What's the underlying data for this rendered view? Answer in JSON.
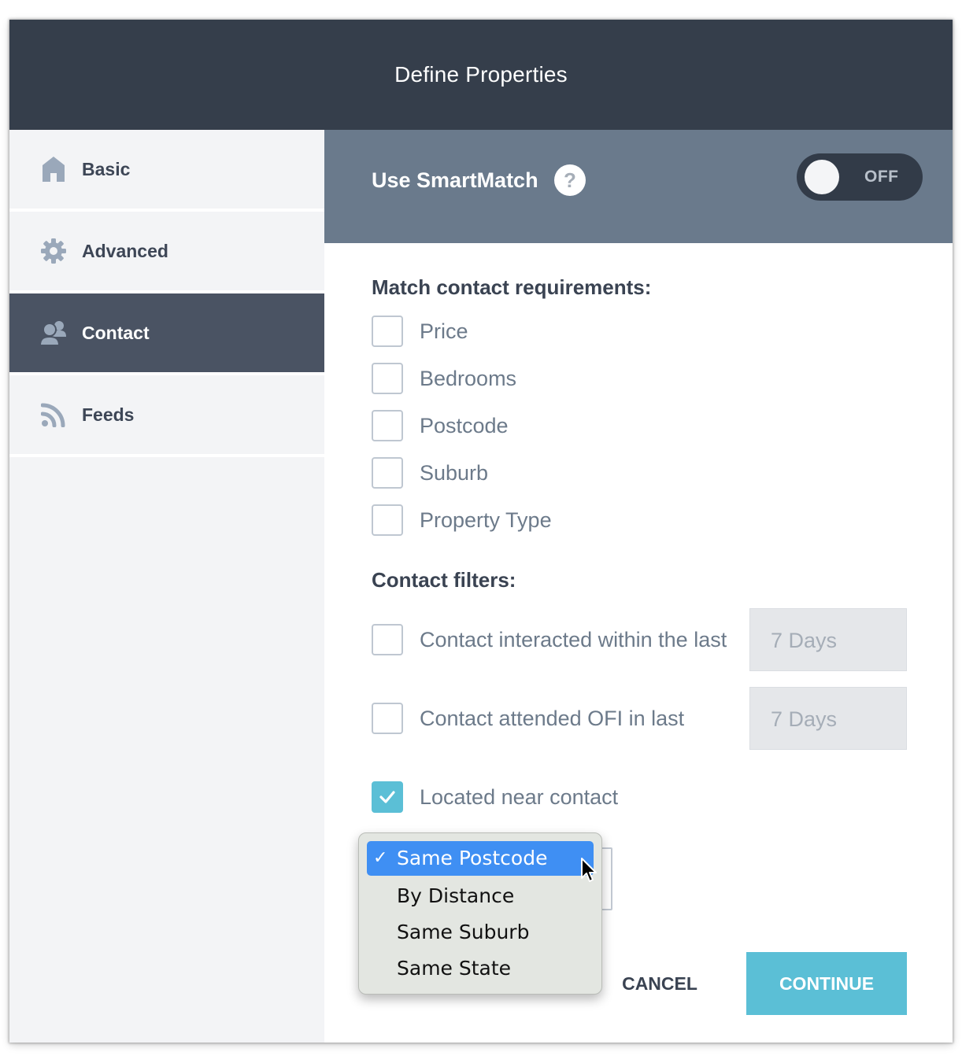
{
  "dialog": {
    "title": "Define Properties"
  },
  "sidebar": {
    "items": [
      {
        "label": "Basic",
        "icon": "home-icon",
        "active": false
      },
      {
        "label": "Advanced",
        "icon": "gear-icon",
        "active": false
      },
      {
        "label": "Contact",
        "icon": "contacts-icon",
        "active": true
      },
      {
        "label": "Feeds",
        "icon": "rss-icon",
        "active": false
      }
    ]
  },
  "smartmatch": {
    "title": "Use SmartMatch",
    "help_glyph": "?",
    "toggle_state": "OFF"
  },
  "requirements": {
    "title": "Match contact requirements:",
    "options": [
      {
        "label": "Price",
        "checked": false
      },
      {
        "label": "Bedrooms",
        "checked": false
      },
      {
        "label": "Postcode",
        "checked": false
      },
      {
        "label": "Suburb",
        "checked": false
      },
      {
        "label": "Property Type",
        "checked": false
      }
    ]
  },
  "filters": {
    "title": "Contact filters:",
    "interacted": {
      "label": "Contact interacted within the last",
      "checked": false,
      "value": "7 Days"
    },
    "attended": {
      "label": "Contact attended OFI in last",
      "checked": false,
      "value": "7 Days"
    },
    "located": {
      "label": "Located near contact",
      "checked": true
    }
  },
  "location_dropdown": {
    "selected": "Same Postcode",
    "check_glyph": "✓",
    "options": [
      "Same Postcode",
      "By Distance",
      "Same Suburb",
      "Same State"
    ]
  },
  "actions": {
    "cancel": "CANCEL",
    "continue": "CONTINUE"
  },
  "colors": {
    "header_bg": "#353e4b",
    "smartmatch_bg": "#6a7a8c",
    "active_nav_bg": "#4a5363",
    "accent": "#5bbfd6",
    "dropdown_highlight": "#3f8ff3"
  }
}
